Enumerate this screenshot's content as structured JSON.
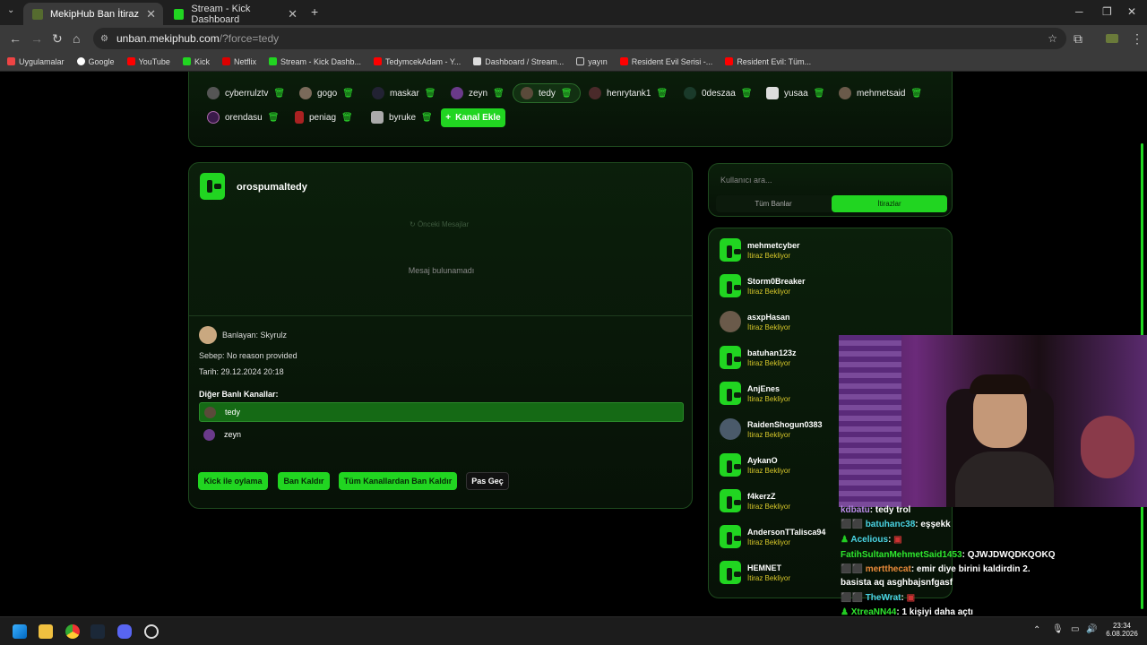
{
  "browser": {
    "tabs": [
      {
        "title": "MekipHub Ban İtiraz",
        "active": true
      },
      {
        "title": "Stream - Kick Dashboard",
        "active": false
      }
    ],
    "url_host": "unban.mekiphub.com",
    "url_path": "/?force=tedy",
    "bookmarks": [
      "Uygulamalar",
      "Google",
      "YouTube",
      "Kick",
      "Netflix",
      "Stream - Kick Dashb...",
      "TedymcekAdam - Y...",
      "Dashboard / Stream...",
      "yayın",
      "Resident Evil Serisi -...",
      "Resident Evil: Tüm..."
    ]
  },
  "channels": {
    "row1": [
      "cyberrulztv",
      "gogo",
      "maskar",
      "zeyn",
      "tedy",
      "henrytank1",
      "0deszaa",
      "yusaa",
      "mehmetsaid"
    ],
    "row2": [
      "orendasu",
      "peniag",
      "byruke"
    ],
    "add_label": "Kanal Ekle"
  },
  "detail": {
    "username": "orospumaltedy",
    "prev_messages": "Önceki Mesajlar",
    "no_messages": "Mesaj bulunamadı",
    "banned_by": "Banlayan: Skyrulz",
    "reason": "Sebep: No reason provided",
    "date": "Tarih: 29.12.2024 20:18",
    "other_channels_title": "Diğer Banlı Kanallar:",
    "other_channels": [
      "tedy",
      "zeyn"
    ],
    "buttons": [
      "Kick ile oylama",
      "Ban Kaldır",
      "Tüm Kanallardan Ban Kaldır",
      "Pas Geç"
    ]
  },
  "sidebar": {
    "search_placeholder": "Kullanıcı ara...",
    "filter_all": "Tüm Banlar",
    "filter_appeals": "İtirazlar",
    "users": [
      {
        "name": "mehmetcyber",
        "status": "İtiraz Bekliyor"
      },
      {
        "name": "Storm0Breaker",
        "status": "İtiraz Bekliyor"
      },
      {
        "name": "asxpHasan",
        "status": "İtiraz Bekliyor"
      },
      {
        "name": "batuhan123z",
        "status": "İtiraz Bekliyor"
      },
      {
        "name": "AnjEnes",
        "status": "İtiraz Bekliyor"
      },
      {
        "name": "RaidenShogun0383",
        "status": "İtiraz Bekliyor"
      },
      {
        "name": "AykanO",
        "status": "İtiraz Bekliyor"
      },
      {
        "name": "f4kerzZ",
        "status": "İtiraz Bekliyor"
      },
      {
        "name": "AndersonTTalisca94",
        "status": "İtiraz Bekliyor"
      },
      {
        "name": "HEMNET",
        "status": "İtiraz Bekliyor"
      }
    ]
  },
  "chat": [
    {
      "user": "kdbatu",
      "msg": ": tedy trol"
    },
    {
      "user": "batuhanc38",
      "msg": ": eşşekk"
    },
    {
      "user": "Acelious",
      "msg": ":"
    },
    {
      "user": "FatihSultanMehmetSaid1453",
      "msg": ": QJWJDWQDKQOKQ"
    },
    {
      "user": "mertthecat",
      "msg": ": emir diye birini kaldirdin 2."
    },
    {
      "user": "",
      "msg": "basista aq asghbajsnfgasf"
    },
    {
      "user": "TheWrat",
      "msg": ":"
    },
    {
      "user": "XtreaNN44",
      "msg": ": 1 kişiyi daha açtı"
    }
  ],
  "taskbar": {
    "time": "23:34",
    "date": "6.08.2026"
  }
}
